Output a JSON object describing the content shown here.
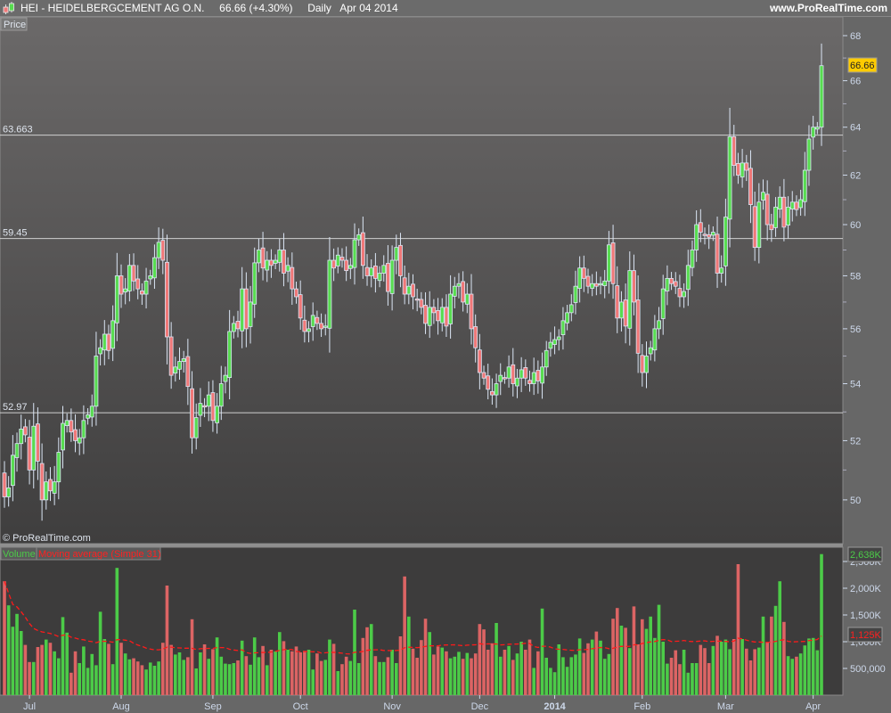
{
  "header": {
    "symbol_title": "HEI - HEIDELBERGCEMENT AG O.N.",
    "last_change": "66.66 (+4.30%)",
    "period": "Daily",
    "date": "Apr 04 2014",
    "site": "www.ProRealTime.com"
  },
  "price_panel": {
    "label": "Price",
    "copyright": "© ProRealTime.com",
    "last_price_badge": "66.66",
    "levels": [
      {
        "value": 63.663,
        "label": "63.663"
      },
      {
        "value": 59.45,
        "label": "59.45"
      },
      {
        "value": 52.97,
        "label": "52.97"
      }
    ]
  },
  "volume_panel": {
    "label_volume": "Volume",
    "label_ma": "Moving average (Simple 31)",
    "last_volume_badge": "2,638K",
    "last_ma_badge": "1,125K"
  },
  "colors": {
    "up": "#58dc50",
    "down": "#f07878",
    "vol_up": "#4ccb48",
    "vol_down": "#dc6464",
    "ma": "#ff1a1a",
    "wick": "#dbe6f5",
    "badge": "#ffcc00"
  },
  "chart_data": [
    {
      "type": "candlestick",
      "title": "HEI - HEIDELBERGCEMENT AG O.N. Daily",
      "scale": "log",
      "ylim": [
        48.5,
        68.3
      ],
      "y_ticks": [
        {
          "v": 68,
          "label": "68"
        },
        {
          "v": 66,
          "label": "66"
        },
        {
          "v": 64,
          "label": "64"
        },
        {
          "v": 62,
          "label": "62"
        },
        {
          "v": 60,
          "label": "60"
        },
        {
          "v": 58,
          "label": "58"
        },
        {
          "v": 56,
          "label": "56"
        },
        {
          "v": 54,
          "label": "54"
        },
        {
          "v": 52,
          "label": "52"
        },
        {
          "v": 50,
          "label": "50"
        }
      ],
      "x_ticks": [
        {
          "label": "Jul",
          "bar": 6
        },
        {
          "label": "Aug",
          "bar": 28
        },
        {
          "label": "Sep",
          "bar": 50
        },
        {
          "label": "Oct",
          "bar": 71
        },
        {
          "label": "Nov",
          "bar": 93
        },
        {
          "label": "Dec",
          "bar": 114
        },
        {
          "label": "2014",
          "bar": 132
        },
        {
          "label": "Feb",
          "bar": 153
        },
        {
          "label": "Mar",
          "bar": 173
        },
        {
          "label": "Apr",
          "bar": 194
        }
      ],
      "close": [
        50.1,
        50.4,
        51.5,
        51.9,
        52.4,
        52.2,
        51.0,
        52.5,
        51.3,
        50.0,
        50.6,
        50.3,
        50.6,
        51.6,
        52.6,
        52.7,
        52.3,
        52.0,
        52.1,
        52.7,
        52.9,
        53.2,
        55.0,
        55.3,
        55.8,
        55.2,
        56.3,
        58.0,
        57.3,
        57.5,
        58.4,
        57.8,
        57.5,
        57.3,
        57.8,
        58.0,
        58.7,
        59.3,
        58.6,
        55.7,
        54.3,
        54.6,
        54.8,
        54.9,
        53.9,
        52.1,
        52.8,
        53.3,
        53.2,
        53.6,
        52.7,
        53.2,
        54.0,
        54.3,
        55.9,
        56.2,
        56.0,
        57.5,
        56.0,
        57.0,
        58.5,
        59.0,
        58.3,
        58.6,
        58.4,
        58.6,
        59.0,
        58.1,
        58.4,
        57.5,
        57.2,
        56.4,
        55.9,
        56.0,
        56.5,
        56.2,
        56.0,
        56.1,
        58.6,
        58.3,
        58.8,
        58.6,
        58.2,
        58.4,
        59.4,
        59.6,
        58.4,
        58.0,
        58.3,
        57.9,
        58.1,
        58.4,
        57.4,
        58.6,
        59.1,
        58.0,
        57.3,
        57.6,
        57.2,
        57.1,
        56.8,
        56.2,
        56.8,
        56.6,
        56.3,
        56.8,
        56.1,
        57.3,
        57.6,
        57.7,
        57.0,
        57.3,
        56.0,
        55.3,
        54.4,
        54.2,
        53.8,
        53.6,
        54.0,
        54.3,
        54.2,
        54.6,
        54.0,
        54.2,
        54.5,
        54.2,
        54.0,
        54.4,
        54.1,
        54.6,
        55.2,
        55.5,
        55.6,
        55.7,
        56.3,
        56.6,
        56.9,
        57.6,
        58.3,
        57.9,
        57.6,
        57.7,
        57.6,
        57.7,
        57.8,
        59.2,
        57.7,
        56.4,
        57.0,
        56.1,
        58.2,
        57.0,
        55.1,
        54.4,
        55.0,
        55.3,
        56.0,
        56.3,
        57.5,
        57.9,
        57.7,
        57.6,
        57.2,
        57.4,
        58.4,
        59.0,
        60.0,
        59.7,
        59.6,
        59.5,
        59.7,
        58.1,
        58.3,
        60.3,
        63.6,
        62.4,
        62.0,
        62.5,
        62.2,
        60.8,
        59.1,
        60.9,
        61.3,
        60.0,
        59.8,
        60.7,
        61.1,
        59.9,
        60.7,
        60.9,
        60.6,
        61.0,
        62.2,
        63.5,
        64.0,
        64.0,
        66.66
      ]
    },
    {
      "type": "bar",
      "title": "Volume",
      "unit": "K",
      "ylim": [
        0,
        2700
      ],
      "y_ticks": [
        {
          "v": 2500,
          "label": "2,500K"
        },
        {
          "v": 2000,
          "label": "2,000K"
        },
        {
          "v": 1500,
          "label": "1,500K"
        },
        {
          "v": 1000,
          "label": "1,000K"
        },
        {
          "v": 500,
          "label": "500,000"
        }
      ],
      "ma_period": 31,
      "values": [
        2130,
        1680,
        1280,
        1520,
        1200,
        940,
        620,
        620,
        900,
        940,
        1040,
        980,
        820,
        690,
        1460,
        1170,
        420,
        820,
        600,
        910,
        510,
        770,
        560,
        1560,
        1050,
        960,
        580,
        2380,
        980,
        780,
        670,
        690,
        630,
        560,
        480,
        610,
        550,
        630,
        980,
        2050,
        940,
        760,
        800,
        660,
        710,
        1420,
        500,
        800,
        950,
        680,
        860,
        1080,
        720,
        590,
        580,
        600,
        650,
        1020,
        730,
        570,
        1080,
        710,
        920,
        560,
        850,
        820,
        1180,
        1010,
        850,
        820,
        910,
        800,
        830,
        850,
        480,
        780,
        640,
        660,
        1040,
        960,
        450,
        580,
        720,
        640,
        1600,
        600,
        1070,
        1270,
        1330,
        730,
        620,
        620,
        710,
        850,
        600,
        1100,
        2220,
        1470,
        870,
        700,
        1030,
        1430,
        1180,
        760,
        910,
        890,
        820,
        690,
        720,
        810,
        680,
        790,
        690,
        780,
        1330,
        1230,
        850,
        970,
        1350,
        720,
        850,
        920,
        660,
        780,
        1000,
        850,
        1040,
        510,
        820,
        1620,
        700,
        510,
        430,
        950,
        710,
        530,
        710,
        760,
        1060,
        790,
        970,
        1040,
        1190,
        1020,
        680,
        770,
        1430,
        1630,
        1300,
        1260,
        880,
        1660,
        950,
        1420,
        1240,
        1470,
        1070,
        1690,
        1000,
        590,
        700,
        840,
        580,
        850,
        420,
        600,
        600,
        940,
        880,
        600,
        920,
        1110,
        1000,
        1040,
        860,
        1050,
        2450,
        1050,
        870,
        650,
        860,
        890,
        1470,
        1000,
        1470,
        1670,
        2130,
        1370,
        730,
        680,
        720,
        780,
        930,
        1060,
        1070,
        840,
        2638
      ]
    }
  ]
}
